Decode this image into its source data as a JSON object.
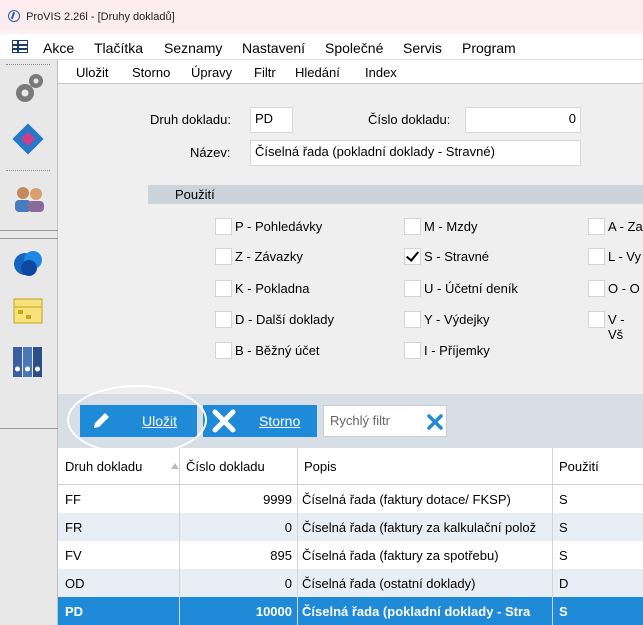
{
  "window": {
    "title": "ProVIS 2.26l - [Druhy dokladů]"
  },
  "menu": [
    "Akce",
    "Tlačítka",
    "Seznamy",
    "Nastavení",
    "Společné",
    "Servis",
    "Program"
  ],
  "toolbar": [
    "Uložit",
    "Storno",
    "Úpravy",
    "Filtr",
    "Hledání",
    "Index"
  ],
  "form": {
    "druh_label": "Druh dokladu:",
    "druh_value": "PD",
    "cislo_label": "Číslo dokladu:",
    "cislo_value": "0",
    "nazev_label": "Název:",
    "nazev_value": "Číselná řada (pokladní doklady - Stravné)"
  },
  "section_title": "Použití",
  "checkboxes": [
    {
      "label": "P - Pohledávky",
      "checked": false
    },
    {
      "label": "Z - Závazky",
      "checked": false
    },
    {
      "label": "K - Pokladna",
      "checked": false
    },
    {
      "label": "D - Další doklady",
      "checked": false
    },
    {
      "label": "B - Běžný účet",
      "checked": false
    },
    {
      "label": "M - Mzdy",
      "checked": false
    },
    {
      "label": "S - Stravné",
      "checked": true
    },
    {
      "label": "U - Účetní deník",
      "checked": false
    },
    {
      "label": "Y - Výdejky",
      "checked": false
    },
    {
      "label": "I - Příjemky",
      "checked": false
    },
    {
      "label": "A - Za",
      "checked": false
    },
    {
      "label": "L - Vy",
      "checked": false
    },
    {
      "label": "O - O",
      "checked": false
    },
    {
      "label": "V - Vš",
      "checked": false
    }
  ],
  "actions": {
    "save": "Uložit",
    "cancel": "Storno",
    "quick_filter_placeholder": "Rychlý filtr"
  },
  "table": {
    "headers": [
      "Druh dokladu",
      "Číslo dokladu",
      "Popis",
      "Použití"
    ],
    "rows": [
      [
        "FF",
        "9999",
        "Číselná řada (faktury dotace/ FKSP)",
        "S"
      ],
      [
        "FR",
        "0",
        "Číselná řada (faktury za kalkulační polož",
        "S"
      ],
      [
        "FV",
        "895",
        "Číselná řada (faktury za spotřebu)",
        "S"
      ],
      [
        "OD",
        "0",
        "Číselná řada (ostatní doklady)",
        "D"
      ],
      [
        "PD",
        "10000",
        "Číselná řada (pokladní doklady - Stra",
        "S"
      ]
    ],
    "selected_row": 4
  },
  "colors": {
    "accent": "#1f8ad8",
    "panel": "#efefef",
    "section": "#cdd3da"
  }
}
